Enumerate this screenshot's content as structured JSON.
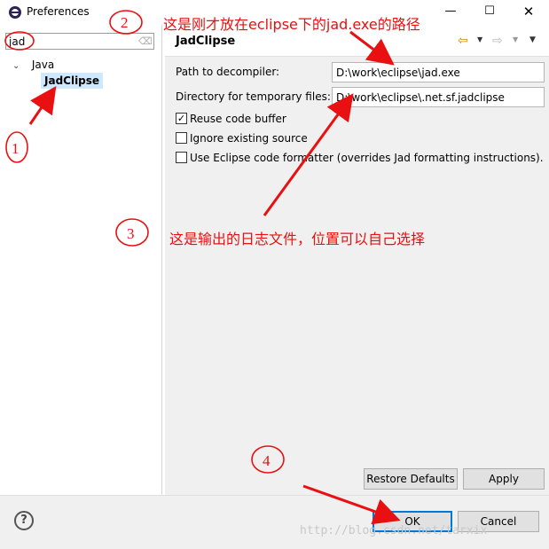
{
  "window": {
    "title": "Preferences",
    "controls": {
      "minimize": "—",
      "maximize": "☐",
      "close": "✕"
    }
  },
  "sidebar": {
    "filter_value": "jad",
    "tree": [
      {
        "label": "Java",
        "expanded": true
      },
      {
        "label": "JadClipse",
        "selected": true
      }
    ]
  },
  "page": {
    "title": "JadClipse",
    "fields": [
      {
        "label": "Path to decompiler:",
        "value": "D:\\work\\eclipse\\jad.exe"
      },
      {
        "label": "Directory for temporary files:",
        "value": "D:\\work\\eclipse\\.net.sf.jadclipse"
      }
    ],
    "checkboxes": [
      {
        "label": "Reuse code buffer",
        "checked": true
      },
      {
        "label": "Ignore existing source",
        "checked": false
      },
      {
        "label": "Use Eclipse code formatter (overrides Jad formatting instructions).",
        "checked": false
      }
    ],
    "buttons": {
      "restore": "Restore Defaults",
      "apply": "Apply"
    }
  },
  "footer": {
    "help": "?",
    "ok": "OK",
    "cancel": "Cancel"
  },
  "annotations": {
    "color": "#e81010",
    "markers": [
      "1",
      "2",
      "3",
      "4"
    ],
    "note_decompiler": "这是刚才放在eclipse下的jad.exe的路径",
    "note_log": "这是输出的日志文件，位置可以自己选择"
  },
  "watermark": "http://blog.csdn.net/tarxix"
}
